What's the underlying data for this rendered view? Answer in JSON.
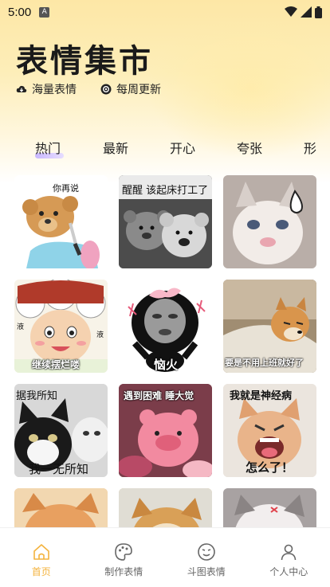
{
  "status": {
    "time": "5:00",
    "badge": "A"
  },
  "header": {
    "title": "表情集市",
    "features": [
      {
        "icon": "cloud-icon",
        "label": "海量表情"
      },
      {
        "icon": "refresh-icon",
        "label": "每周更新"
      }
    ]
  },
  "tabs": [
    "热门",
    "最新",
    "开心",
    "夸张",
    "形"
  ],
  "active_tab": "热门",
  "stickers": [
    {
      "caption": "你再说"
    },
    {
      "caption": "醒醒 该起床打工了"
    },
    {
      "caption": ""
    },
    {
      "caption": "继续摆烂喽",
      "side_left": "液",
      "side_right": "液"
    },
    {
      "caption": "恼火"
    },
    {
      "caption": "要是不用上班就好了"
    },
    {
      "caption": "据我所知",
      "caption2": "我一无所知"
    },
    {
      "caption": "遇到困难  睡大觉"
    },
    {
      "caption": "我就是神经病",
      "caption2": "怎么了！"
    },
    {
      "caption": ""
    },
    {
      "caption": ""
    },
    {
      "caption": ""
    }
  ],
  "nav": [
    {
      "label": "首页",
      "icon": "home-icon"
    },
    {
      "label": "制作表情",
      "icon": "palette-icon"
    },
    {
      "label": "斗图表情",
      "icon": "emoji-icon"
    },
    {
      "label": "个人中心",
      "icon": "user-icon"
    }
  ],
  "colors": {
    "accent": "#f4b33e",
    "tab_highlight": "#c9b8ff"
  }
}
